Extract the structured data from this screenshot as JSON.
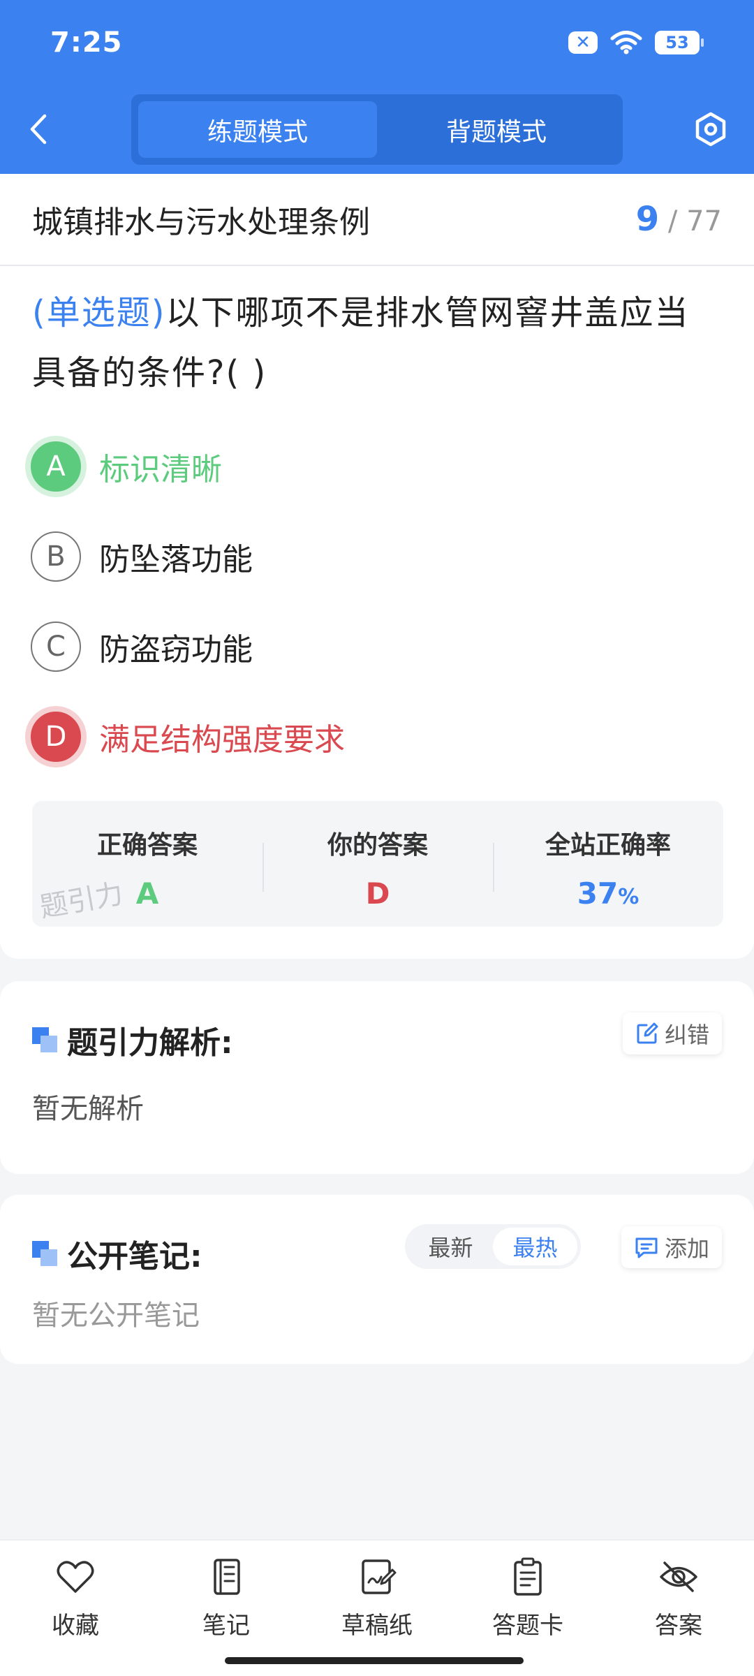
{
  "status_bar": {
    "time": "7:25",
    "battery": "53"
  },
  "header": {
    "modes": [
      {
        "label": "练题模式",
        "active": true
      },
      {
        "label": "背题模式",
        "active": false
      }
    ]
  },
  "question": {
    "chapter": "城镇排水与污水处理条例",
    "current": "9",
    "total": "/ 77",
    "type": "(单选题)",
    "text": "以下哪项不是排水管网窨井盖应当具备的条件?(        )",
    "options": [
      {
        "letter": "A",
        "text": "标识清晰",
        "state": "correct"
      },
      {
        "letter": "B",
        "text": "防坠落功能",
        "state": "normal"
      },
      {
        "letter": "C",
        "text": "防盗窃功能",
        "state": "normal"
      },
      {
        "letter": "D",
        "text": "满足结构强度要求",
        "state": "wrong"
      }
    ]
  },
  "stats": {
    "correct_label": "正确答案",
    "correct_value": "A",
    "yours_label": "你的答案",
    "yours_value": "D",
    "rate_label": "全站正确率",
    "rate_value": "37",
    "rate_unit": "%",
    "watermark": "题引力"
  },
  "analysis": {
    "title": "题引力解析:",
    "report_label": "纠错",
    "empty": "暂无解析"
  },
  "notes": {
    "title": "公开笔记:",
    "sort_newest": "最新",
    "sort_hot": "最热",
    "add_label": "添加",
    "empty": "暂无公开笔记"
  },
  "bottom_tabs": [
    {
      "label": "收藏",
      "icon": "heart-icon"
    },
    {
      "label": "笔记",
      "icon": "notebook-icon"
    },
    {
      "label": "草稿纸",
      "icon": "draft-icon"
    },
    {
      "label": "答题卡",
      "icon": "clipboard-icon"
    },
    {
      "label": "答案",
      "icon": "eye-off-icon"
    }
  ],
  "colors": {
    "primary": "#3b82f0",
    "correct": "#5ccb7e",
    "wrong": "#d9494f"
  }
}
